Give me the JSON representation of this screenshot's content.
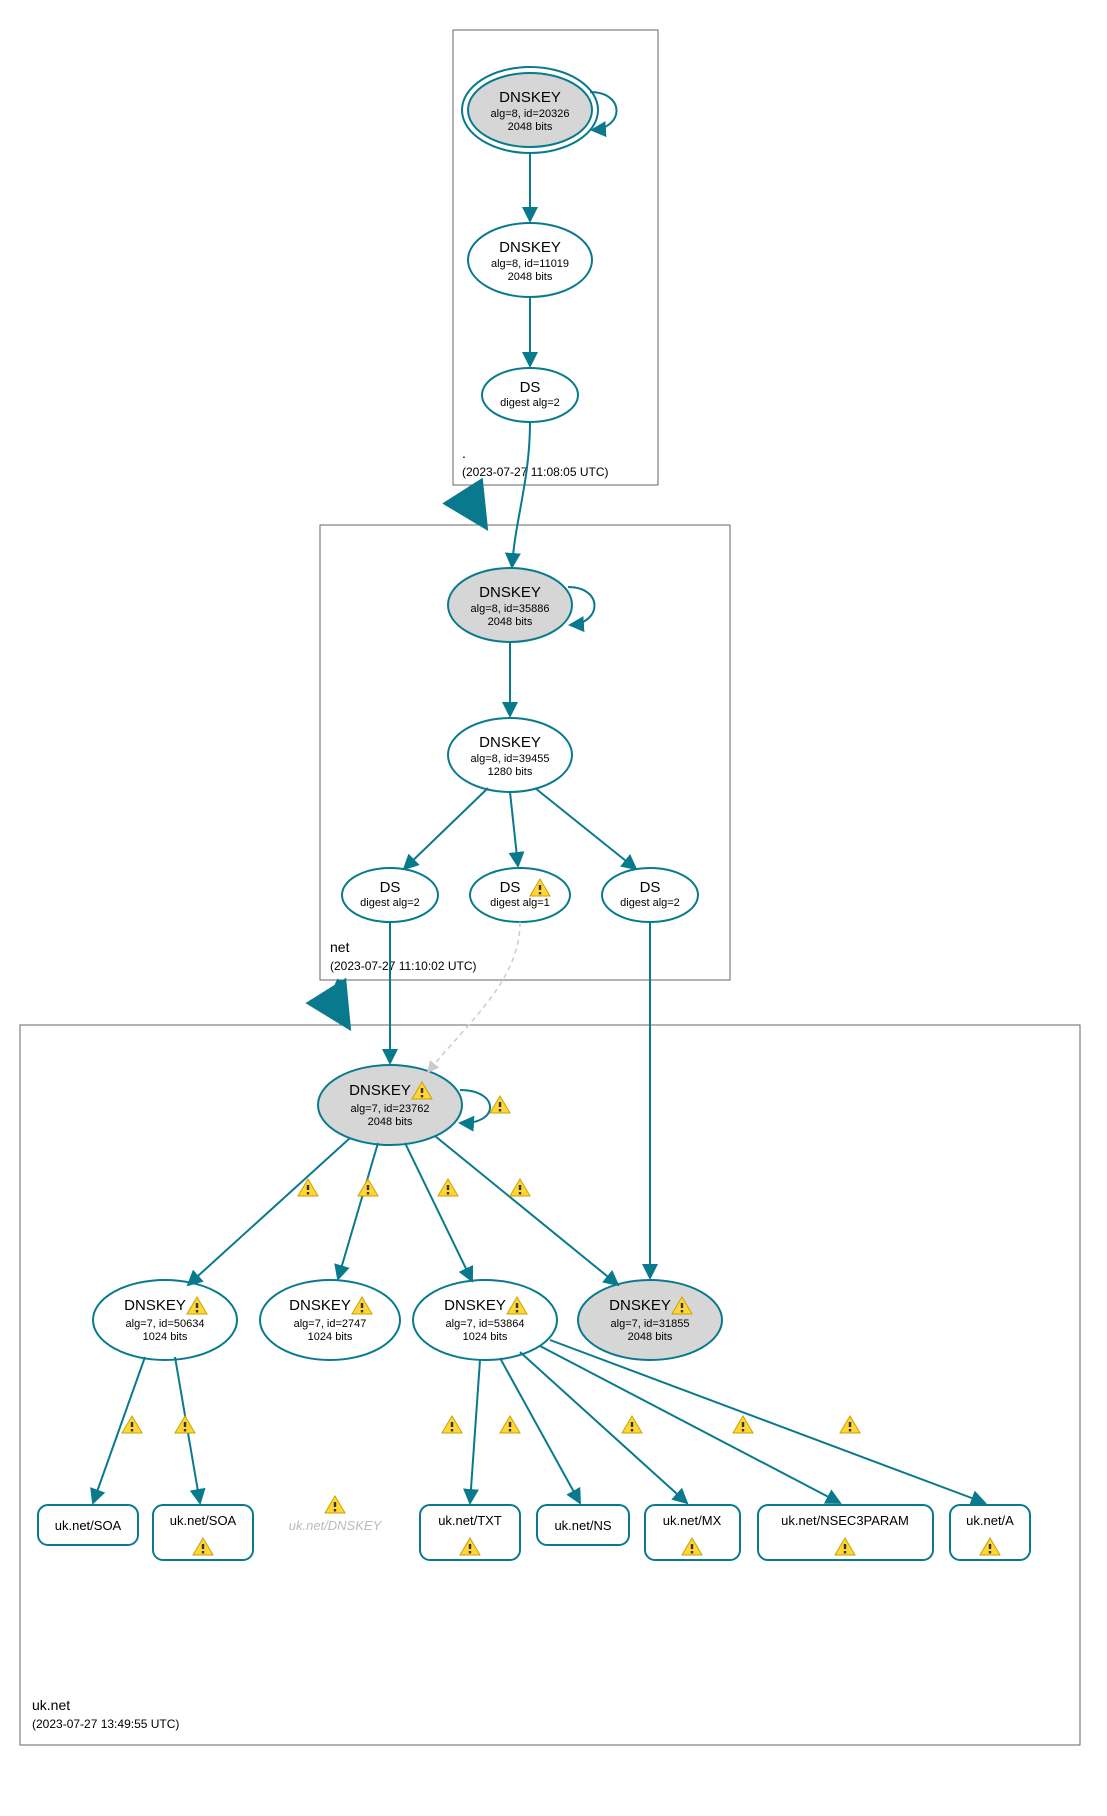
{
  "zones": {
    "root": {
      "name": ".",
      "timestamp": "(2023-07-27 11:08:05 UTC)"
    },
    "net": {
      "name": "net",
      "timestamp": "(2023-07-27 11:10:02 UTC)"
    },
    "uknet": {
      "name": "uk.net",
      "timestamp": "(2023-07-27 13:49:55 UTC)"
    }
  },
  "nodes": {
    "root_dnskey1": {
      "title": "DNSKEY",
      "line1": "alg=8, id=20326",
      "line2": "2048 bits"
    },
    "root_dnskey2": {
      "title": "DNSKEY",
      "line1": "alg=8, id=11019",
      "line2": "2048 bits"
    },
    "root_ds": {
      "title": "DS",
      "line1": "digest alg=2"
    },
    "net_dnskey1": {
      "title": "DNSKEY",
      "line1": "alg=8, id=35886",
      "line2": "2048 bits"
    },
    "net_dnskey2": {
      "title": "DNSKEY",
      "line1": "alg=8, id=39455",
      "line2": "1280 bits"
    },
    "net_ds1": {
      "title": "DS",
      "line1": "digest alg=2"
    },
    "net_ds2": {
      "title": "DS",
      "line1": "digest alg=1",
      "warn": true
    },
    "net_ds3": {
      "title": "DS",
      "line1": "digest alg=2"
    },
    "uknet_dnskey1": {
      "title": "DNSKEY",
      "line1": "alg=7, id=23762",
      "line2": "2048 bits",
      "warn": true
    },
    "uknet_dnskey2": {
      "title": "DNSKEY",
      "line1": "alg=7, id=50634",
      "line2": "1024 bits",
      "warn": true
    },
    "uknet_dnskey3": {
      "title": "DNSKEY",
      "line1": "alg=7, id=2747",
      "line2": "1024 bits",
      "warn": true
    },
    "uknet_dnskey4": {
      "title": "DNSKEY",
      "line1": "alg=7, id=53864",
      "line2": "1024 bits",
      "warn": true
    },
    "uknet_dnskey5": {
      "title": "DNSKEY",
      "line1": "alg=7, id=31855",
      "line2": "2048 bits",
      "warn": true
    }
  },
  "rrsets": {
    "soa1": {
      "label": "uk.net/SOA"
    },
    "soa2": {
      "label": "uk.net/SOA",
      "warn": true
    },
    "dnskey_f": {
      "label": "uk.net/DNSKEY",
      "faded": true
    },
    "txt": {
      "label": "uk.net/TXT",
      "warn": true
    },
    "ns": {
      "label": "uk.net/NS"
    },
    "mx": {
      "label": "uk.net/MX",
      "warn": true
    },
    "nsec3": {
      "label": "uk.net/NSEC3PARAM",
      "warn": true
    },
    "a": {
      "label": "uk.net/A",
      "warn": true
    }
  }
}
